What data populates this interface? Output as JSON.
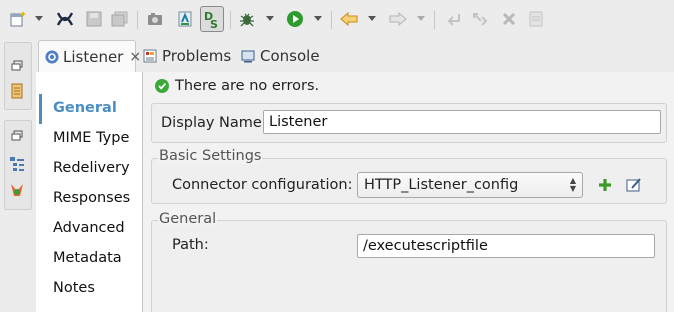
{
  "toolbar": {
    "icons": [
      "new-wizard-icon",
      "mule-icon",
      "save-icon",
      "save-all-icon",
      "camera-icon",
      "deploy-icon",
      "dataweave-icon",
      "debug-icon",
      "run-icon",
      "back-icon",
      "forward-icon",
      "undo-icon",
      "redo-icon",
      "delete-icon",
      "properties-icon"
    ],
    "accent_run": "#2e9b2e",
    "accent_back": "#e8a23a"
  },
  "tabs": [
    {
      "label": "Listener",
      "close": "×",
      "active": true,
      "icon": "listener-icon"
    },
    {
      "label": "Problems",
      "active": false,
      "icon": "problems-icon"
    },
    {
      "label": "Console",
      "active": false,
      "icon": "console-icon"
    }
  ],
  "nav": {
    "active_color": "#4a8ec4",
    "items": [
      "General",
      "MIME Type",
      "Redelivery",
      "Responses",
      "Advanced",
      "Metadata",
      "Notes"
    ]
  },
  "status": {
    "text": "There are no errors.",
    "color": "#3aa93a"
  },
  "display_name": {
    "label": "Display Name:",
    "value": "Listener"
  },
  "basic_settings": {
    "title": "Basic Settings",
    "connector_label": "Connector configuration:",
    "connector_value": "HTTP_Listener_config"
  },
  "general_group": {
    "title": "General",
    "path_label": "Path:",
    "path_value": "/executescriptfile"
  }
}
